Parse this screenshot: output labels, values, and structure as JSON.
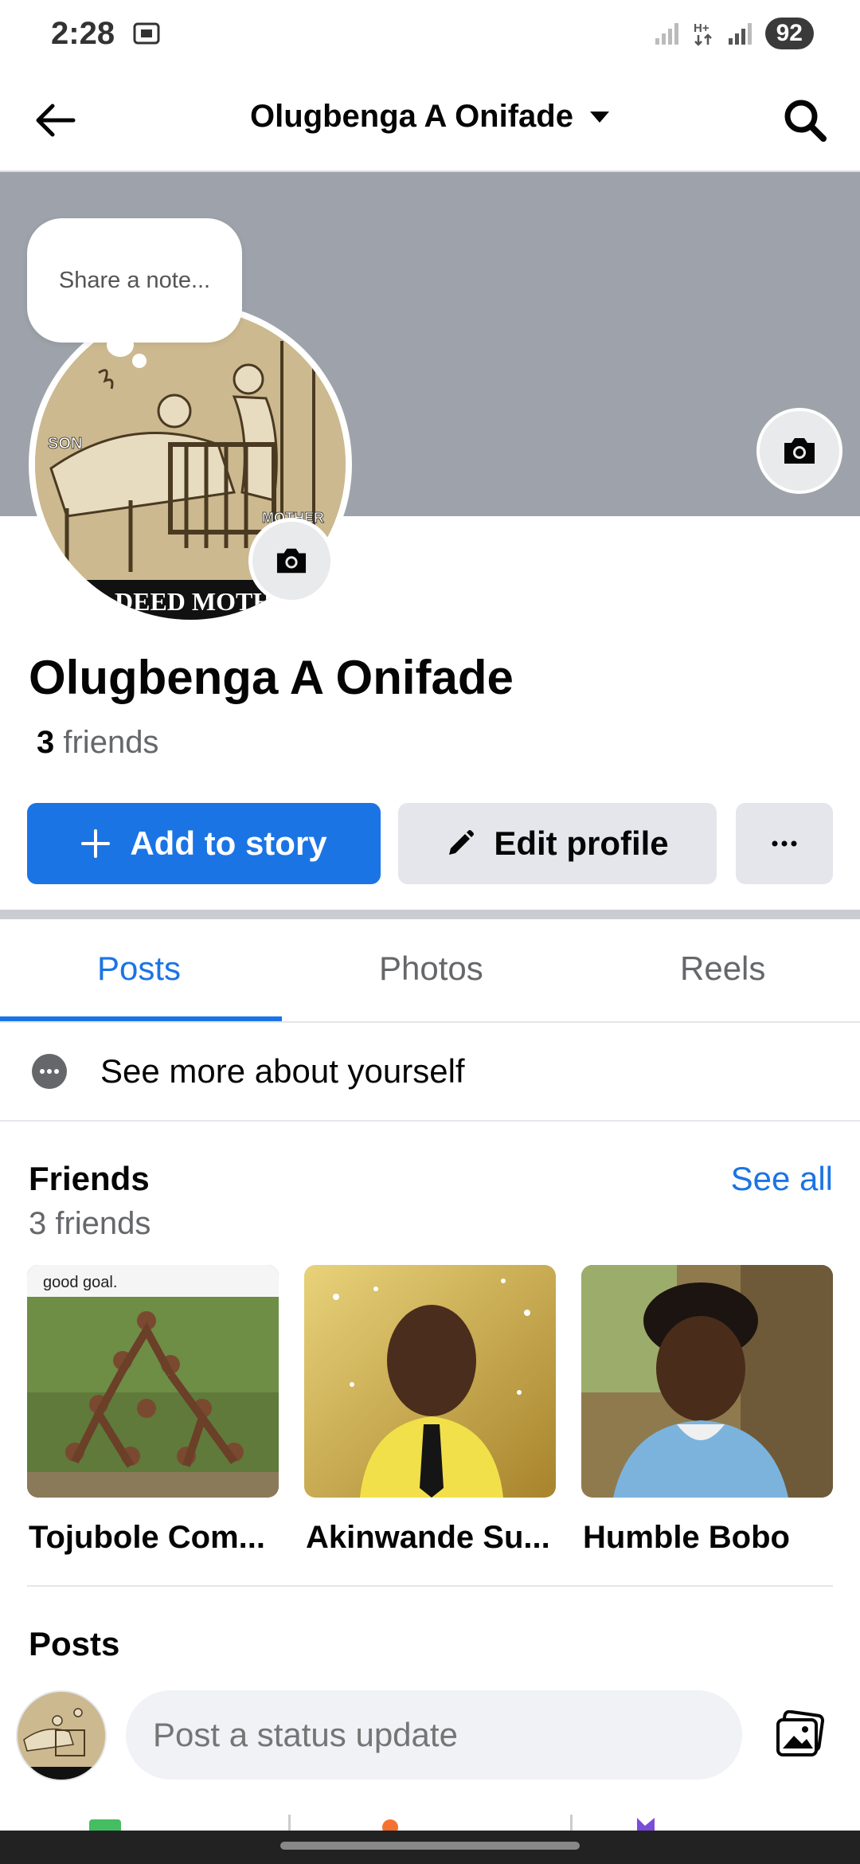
{
  "status_bar": {
    "time": "2:28",
    "battery": "92"
  },
  "header": {
    "title": "Olugbenga A Onifade"
  },
  "note": {
    "placeholder": "Share a note..."
  },
  "profile": {
    "name": "Olugbenga A Onifade",
    "friends_count": "3",
    "friends_word": "friends",
    "avatar_labels": [
      "SON",
      "MOTHER",
      "DEED MOTHER"
    ]
  },
  "actions": {
    "add_story": "Add to story",
    "edit_profile": "Edit profile"
  },
  "tabs": [
    {
      "label": "Posts",
      "active": true
    },
    {
      "label": "Photos",
      "active": false
    },
    {
      "label": "Reels",
      "active": false
    }
  ],
  "about": {
    "label": "See more about yourself"
  },
  "friends_section": {
    "title": "Friends",
    "subtitle": "3 friends",
    "see_all": "See all",
    "friends": [
      {
        "name": "Tojubole Com...",
        "photo_caption": "good goal."
      },
      {
        "name": "Akinwande Su..."
      },
      {
        "name": "Humble Bobo"
      }
    ]
  },
  "posts_section": {
    "title": "Posts",
    "status_placeholder": "Post a status update"
  },
  "colors": {
    "accent": "#1b74e4",
    "cover": "#9ea3ab",
    "button_gray": "#e4e6eb"
  }
}
